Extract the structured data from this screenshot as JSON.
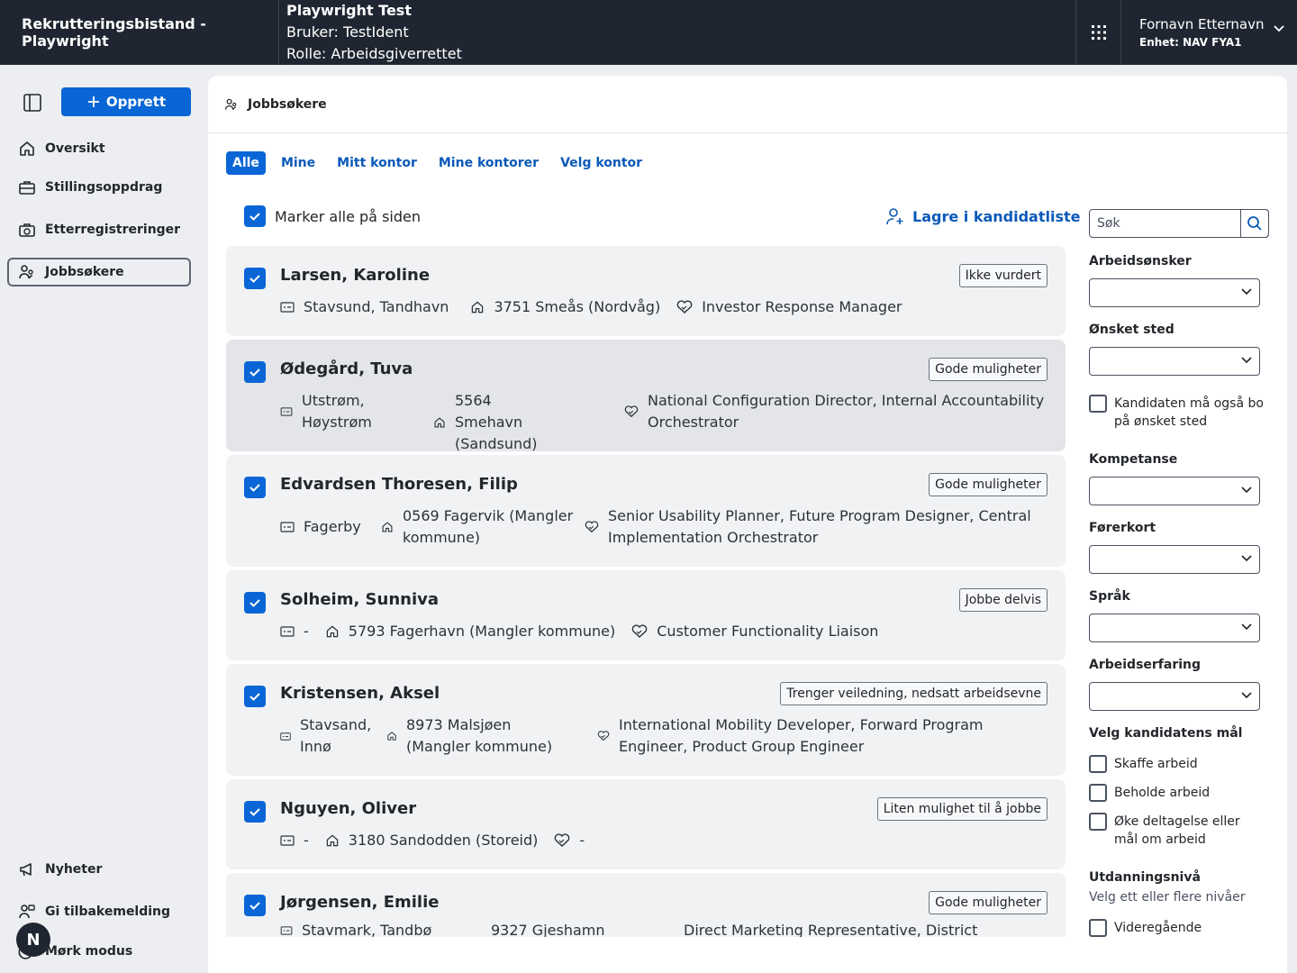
{
  "header": {
    "app_title": "Rekrutteringsbistand - Playwright",
    "env_title": "Playwright Test",
    "env_user": "Bruker: TestIdent",
    "env_role": "Rolle: Arbeidsgiverrettet",
    "user_name": "Fornavn Etternavn",
    "user_unit": "Enhet: NAV FYA1"
  },
  "sidebar": {
    "create_label": "Opprett",
    "items": [
      {
        "label": "Oversikt",
        "icon": "house-icon"
      },
      {
        "label": "Stillingsoppdrag",
        "icon": "briefcase-icon"
      },
      {
        "label": "Etterregistreringer",
        "icon": "briefcase-clock-icon"
      },
      {
        "label": "Jobbsøkere",
        "icon": "people-icon"
      }
    ],
    "bottom": [
      {
        "label": "Nyheter",
        "icon": "megaphone-icon"
      },
      {
        "label": "Gi tilbakemelding",
        "icon": "feedback-icon"
      },
      {
        "label": "Mørk modus",
        "icon": "moon-icon"
      }
    ],
    "avatar_letter": "N"
  },
  "main": {
    "page_title": "Jobbsøkere",
    "tabs": [
      "Alle",
      "Mine",
      "Mitt kontor",
      "Mine kontorer",
      "Velg kontor"
    ],
    "select_all": "Marker alle på siden",
    "save_list": "Lagre i kandidatliste"
  },
  "candidates": [
    {
      "name": "Larsen, Karoline",
      "badge": "Ikke vurdert",
      "address": "Stavsund, Tandhavn",
      "postal": "3751 Smeås (Nordvåg)",
      "job": "Investor Response Manager"
    },
    {
      "name": "Ødegård, Tuva",
      "badge": "Gode muligheter",
      "address": "Utstrøm, Høystrøm",
      "postal": "5564 Smehavn (Sandsund)",
      "job": "National Configuration Director, Internal Accountability Orchestrator"
    },
    {
      "name": "Edvardsen Thoresen, Filip",
      "badge": "Gode muligheter",
      "address": "Fagerby",
      "postal": "0569 Fagervik (Mangler kommune)",
      "job": "Senior Usability Planner, Future Program Designer, Central Implementation Orchestrator"
    },
    {
      "name": "Solheim, Sunniva",
      "badge": "Jobbe delvis",
      "address": "-",
      "postal": "5793 Fagerhavn (Mangler kommune)",
      "job": "Customer Functionality Liaison"
    },
    {
      "name": "Kristensen, Aksel",
      "badge": "Trenger veiledning, nedsatt arbeidsevne",
      "address": "Stavsand, Innø",
      "postal": "8973 Malsjøen (Mangler kommune)",
      "job": "International Mobility Developer, Forward Program Engineer, Product Group Engineer"
    },
    {
      "name": "Nguyen, Oliver",
      "badge": "Liten mulighet til å jobbe",
      "address": "-",
      "postal": "3180 Sandodden (Storeid)",
      "job": "-"
    },
    {
      "name": "Jørgensen, Emilie",
      "badge": "Gode muligheter",
      "address": "Stavmark, Tandbø",
      "postal": "9327 Gjeshamn",
      "job": "Direct Marketing Representative, District Applications"
    }
  ],
  "filters": {
    "search_placeholder": "Søk",
    "arbeidsonsker": "Arbeidsønsker",
    "onsket_sted": "Ønsket sted",
    "bo_paa": "Kandidaten må også bo på ønsket sted",
    "kompetanse": "Kompetanse",
    "forerkort": "Førerkort",
    "sprak": "Språk",
    "arbeidserfaring": "Arbeidserfaring",
    "maal_title": "Velg kandidatens mål",
    "maal": [
      "Skaffe arbeid",
      "Beholde arbeid",
      "Øke deltagelse eller mål om arbeid"
    ],
    "utdanning_title": "Utdanningsnivå",
    "utdanning_desc": "Velg ett eller flere nivåer",
    "utdanning_first": "Videregående"
  }
}
